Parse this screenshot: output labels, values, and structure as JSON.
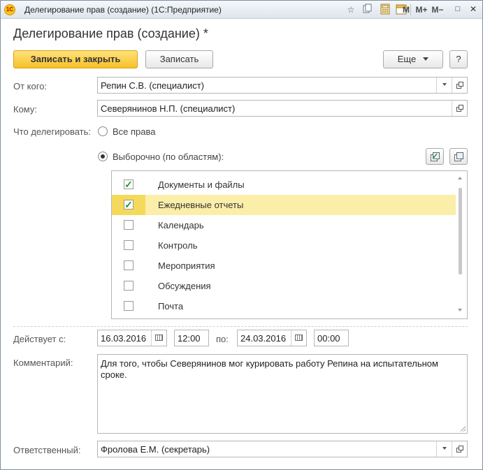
{
  "window": {
    "title": "Делегирование прав (создание)  (1С:Предприятие)",
    "logo": "1С",
    "toolbar_icons": [
      "star-icon",
      "copy-icon",
      "calculator-icon",
      "calendar-icon"
    ],
    "calendar_icon_text": "31",
    "m_labels": [
      "M",
      "M+",
      "M−"
    ],
    "minimize": "—",
    "maximize": "□",
    "close": "✕"
  },
  "form": {
    "title": "Делегирование прав (создание) *",
    "save_close_label": "Записать и закрыть",
    "save_label": "Записать",
    "more_label": "Еще",
    "help_label": "?"
  },
  "from": {
    "label": "От кого:",
    "value": "Репин С.В. (специалист)"
  },
  "to": {
    "label": "Кому:",
    "value": "Северянинов Н.П. (специалист)"
  },
  "what": {
    "label": "Что делегировать:",
    "option_all": "Все права",
    "option_selective": "Выборочно (по областям):",
    "selected": "selective"
  },
  "areas": [
    {
      "label": "Документы и файлы",
      "checked": true,
      "selected": false
    },
    {
      "label": "Ежедневные отчеты",
      "checked": true,
      "selected": true
    },
    {
      "label": "Календарь",
      "checked": false,
      "selected": false
    },
    {
      "label": "Контроль",
      "checked": false,
      "selected": false
    },
    {
      "label": "Мероприятия",
      "checked": false,
      "selected": false
    },
    {
      "label": "Обсуждения",
      "checked": false,
      "selected": false
    },
    {
      "label": "Почта",
      "checked": false,
      "selected": false
    }
  ],
  "validity": {
    "label": "Действует с:",
    "from_date": "16.03.2016",
    "from_time": "12:00",
    "to_label": "по:",
    "to_date": "24.03.2016",
    "to_time": "00:00"
  },
  "comment": {
    "label": "Комментарий:",
    "value": "Для того, чтобы Северянинов мог курировать работу Репина на испытательном сроке."
  },
  "responsible": {
    "label": "Ответственный:",
    "value": "Фролова Е.М. (секретарь)"
  },
  "colors": {
    "primary_button": "#f6c12a",
    "selected_row": "#fbeea9",
    "check": "#1e9a2e"
  }
}
